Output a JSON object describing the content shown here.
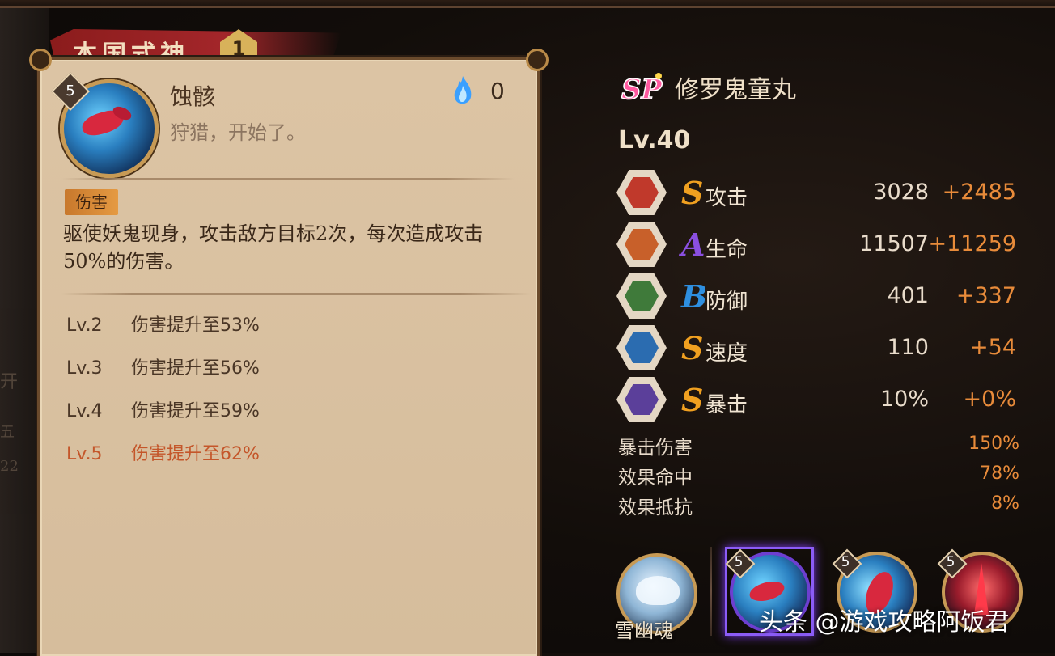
{
  "background_partial_text": [
    "开",
    "五",
    "22"
  ],
  "card": {
    "ribbon_title": "本国式神",
    "ribbon_badge": "1",
    "skill": {
      "level": "5",
      "name": "蚀骸",
      "quote": "狩猎，开始了。",
      "orb_cost": "0",
      "tag": "伤害",
      "description": "驱使妖鬼现身，攻击敌方目标2次，每次造成攻击50%的伤害。"
    },
    "upgrades": [
      {
        "lv": "Lv.2",
        "text": "伤害提升至53%",
        "active": false
      },
      {
        "lv": "Lv.3",
        "text": "伤害提升至56%",
        "active": false
      },
      {
        "lv": "Lv.4",
        "text": "伤害提升至59%",
        "active": false
      },
      {
        "lv": "Lv.5",
        "text": "伤害提升至62%",
        "active": true
      }
    ]
  },
  "shikigami": {
    "rarity": "SP",
    "name": "修罗鬼童丸",
    "level": "Lv.40",
    "stats": [
      {
        "icon": "attack-icon",
        "grade": "S",
        "label": "攻击",
        "base": "3028",
        "bonus": "+2485"
      },
      {
        "icon": "hp-icon",
        "grade": "A",
        "label": "生命",
        "base": "11507",
        "bonus": "+11259"
      },
      {
        "icon": "defense-icon",
        "grade": "B",
        "label": "防御",
        "base": "401",
        "bonus": "+337"
      },
      {
        "icon": "speed-icon",
        "grade": "S",
        "label": "速度",
        "base": "110",
        "bonus": "+54"
      },
      {
        "icon": "crit-icon",
        "grade": "S",
        "label": "暴击",
        "base": "10%",
        "bonus": "+0%"
      }
    ],
    "extra_stats": [
      {
        "label": "暴击伤害",
        "value": "150%"
      },
      {
        "label": "效果命中",
        "value": "78%"
      },
      {
        "label": "效果抵抗",
        "value": "8%"
      }
    ]
  },
  "bottom_skills": {
    "passive_name": "雪幽魂",
    "skill_levels": [
      "5",
      "5",
      "5"
    ]
  },
  "watermark": "头条 @游戏攻略阿饭君",
  "colors": {
    "accent_orange": "#e88b3a",
    "active_level_red": "#c4562a",
    "grade_S": "#f0a020",
    "grade_A": "#8a4fe0",
    "grade_B": "#2e8fe0",
    "selection_purple": "#8b5cf6"
  }
}
